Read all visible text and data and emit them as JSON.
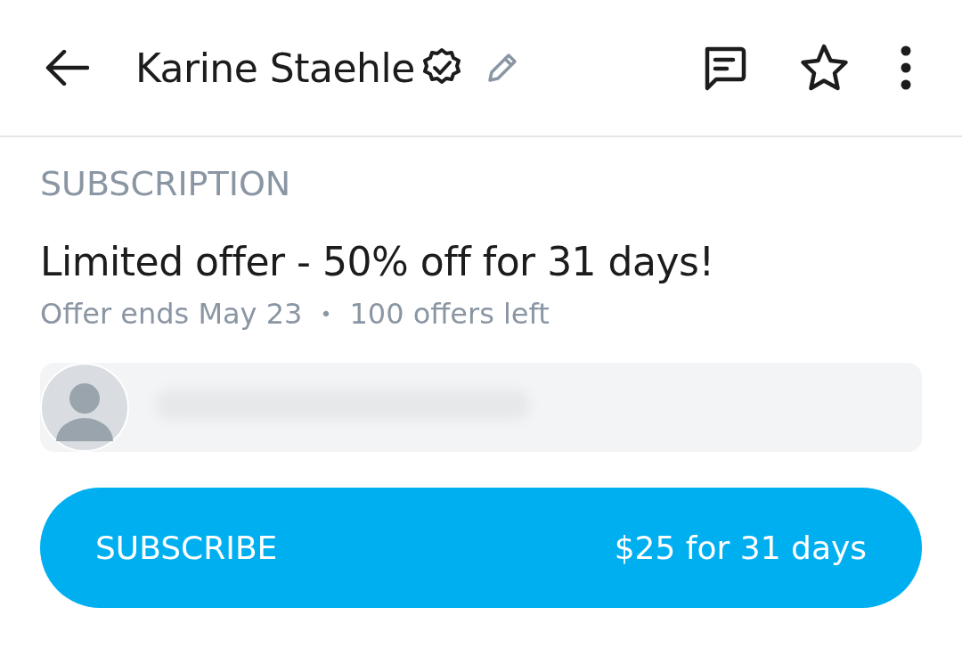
{
  "header": {
    "title": "Karine Staehle",
    "verified": true
  },
  "subscription": {
    "section_label": "SUBSCRIPTION",
    "offer_title": "Limited offer - 50% off for 31 days!",
    "offer_ends": "Offer ends May 23",
    "separator": "•",
    "offers_left": "100 offers left"
  },
  "message": {
    "blurred": true
  },
  "subscribe_button": {
    "label": "SUBSCRIBE",
    "price": "$25 for 31 days"
  }
}
